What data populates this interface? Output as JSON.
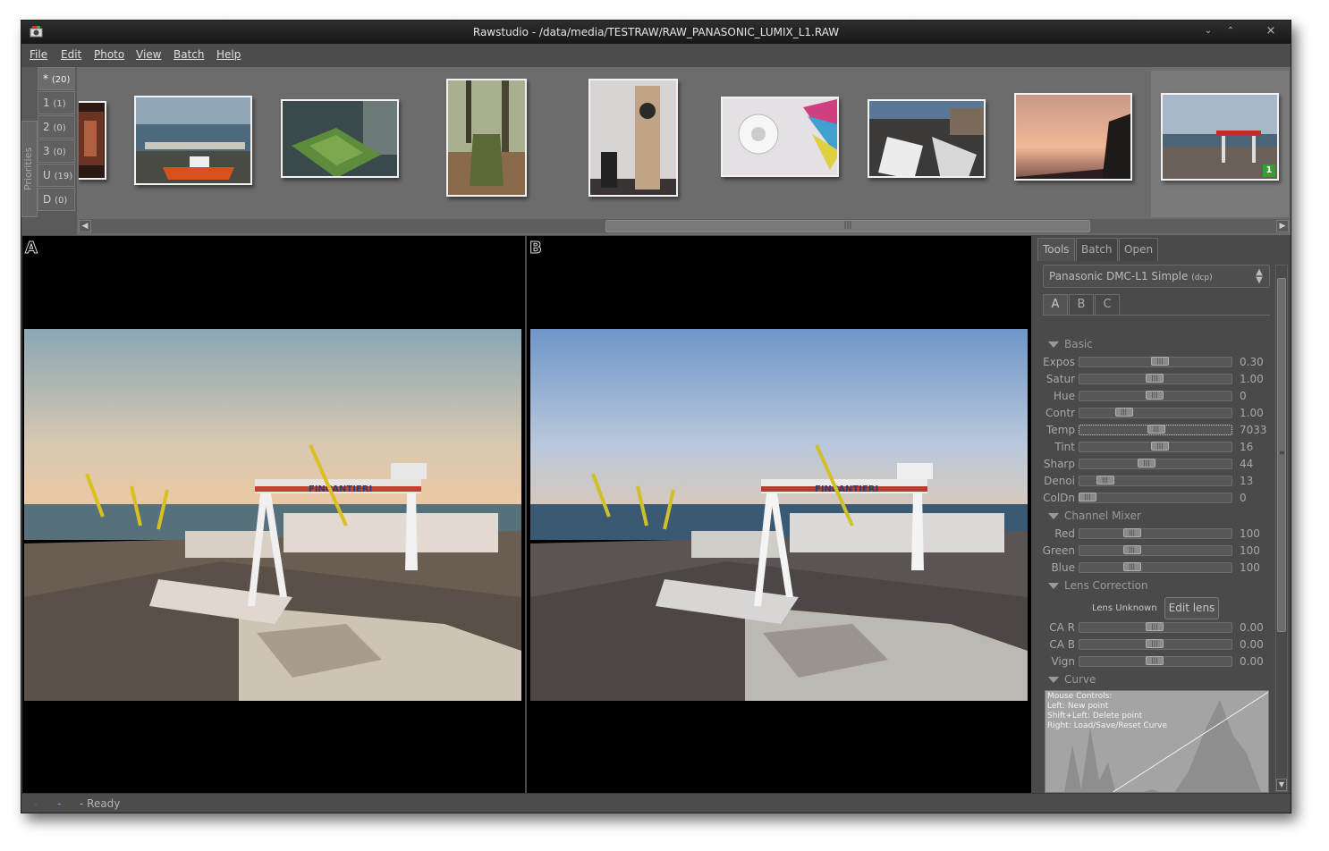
{
  "window": {
    "title": "Rawstudio - /data/media/TESTRAW/RAW_PANASONIC_LUMIX_L1.RAW",
    "controls": {
      "minimize": "⌄",
      "maximize": "⌃",
      "close": "×"
    }
  },
  "menu": [
    "File",
    "Edit",
    "Photo",
    "View",
    "Batch",
    "Help"
  ],
  "priorities": {
    "label": "Priorities",
    "tabs": [
      {
        "name": "*",
        "count": "(20)"
      },
      {
        "name": "1",
        "count": "(1)"
      },
      {
        "name": "2",
        "count": "(0)"
      },
      {
        "name": "3",
        "count": "(0)"
      },
      {
        "name": "U",
        "count": "(19)"
      },
      {
        "name": "D",
        "count": "(0)"
      }
    ]
  },
  "thumbnails": [
    {
      "name": "thumb-wine-partial"
    },
    {
      "name": "thumb-harbor-boats"
    },
    {
      "name": "thumb-courtyard"
    },
    {
      "name": "thumb-tree-stump"
    },
    {
      "name": "thumb-speaker"
    },
    {
      "name": "thumb-color-chart"
    },
    {
      "name": "thumb-boats-dock"
    },
    {
      "name": "thumb-sunset"
    },
    {
      "name": "thumb-shipyard",
      "badge": "1"
    }
  ],
  "viewers": {
    "a_label": "A",
    "b_label": "B",
    "sign_text": "FINCANTIERI"
  },
  "tools": {
    "tabs": [
      "Tools",
      "Batch",
      "Open"
    ],
    "profile": {
      "name": "Panasonic DMC-L1 Simple",
      "suffix": "(dcp)"
    },
    "snapshots": [
      "A",
      "B",
      "C"
    ],
    "basic": {
      "title": "Basic",
      "rows": [
        {
          "label": "Expos",
          "value": "0.30",
          "pos": 0.54
        },
        {
          "label": "Satur",
          "value": "1.00",
          "pos": 0.5
        },
        {
          "label": "Hue",
          "value": "0",
          "pos": 0.5
        },
        {
          "label": "Contr",
          "value": "1.00",
          "pos": 0.27
        },
        {
          "label": "Temp",
          "value": "7033",
          "pos": 0.51
        },
        {
          "label": "Tint",
          "value": "16",
          "pos": 0.54
        },
        {
          "label": "Sharp",
          "value": "44",
          "pos": 0.44
        },
        {
          "label": "Denoi",
          "value": "13",
          "pos": 0.13
        },
        {
          "label": "ColDn",
          "value": "0",
          "pos": 0.0
        }
      ]
    },
    "channel_mixer": {
      "title": "Channel Mixer",
      "rows": [
        {
          "label": "Red",
          "value": "100",
          "pos": 0.33
        },
        {
          "label": "Green",
          "value": "100",
          "pos": 0.33
        },
        {
          "label": "Blue",
          "value": "100",
          "pos": 0.33
        }
      ]
    },
    "lens": {
      "title": "Lens Correction",
      "lens_name": "Lens Unknown",
      "edit_button": "Edit lens",
      "rows": [
        {
          "label": "CA R",
          "value": "0.00",
          "pos": 0.5
        },
        {
          "label": "CA B",
          "value": "0.00",
          "pos": 0.5
        },
        {
          "label": "Vign",
          "value": "0.00",
          "pos": 0.5
        }
      ]
    },
    "curve": {
      "title": "Curve",
      "help": [
        "Mouse Controls:",
        "Left: New point",
        "Shift+Left: Delete point",
        "Right: Load/Save/Reset Curve"
      ]
    }
  },
  "status": {
    "text": "- Ready",
    "dot1": "-",
    "dot2": "-"
  },
  "colors": {
    "window_bg": "#4a4a4a",
    "strip_bg": "#6c6c6c",
    "viewer_bg": "#000000",
    "badge": "#33a033"
  }
}
